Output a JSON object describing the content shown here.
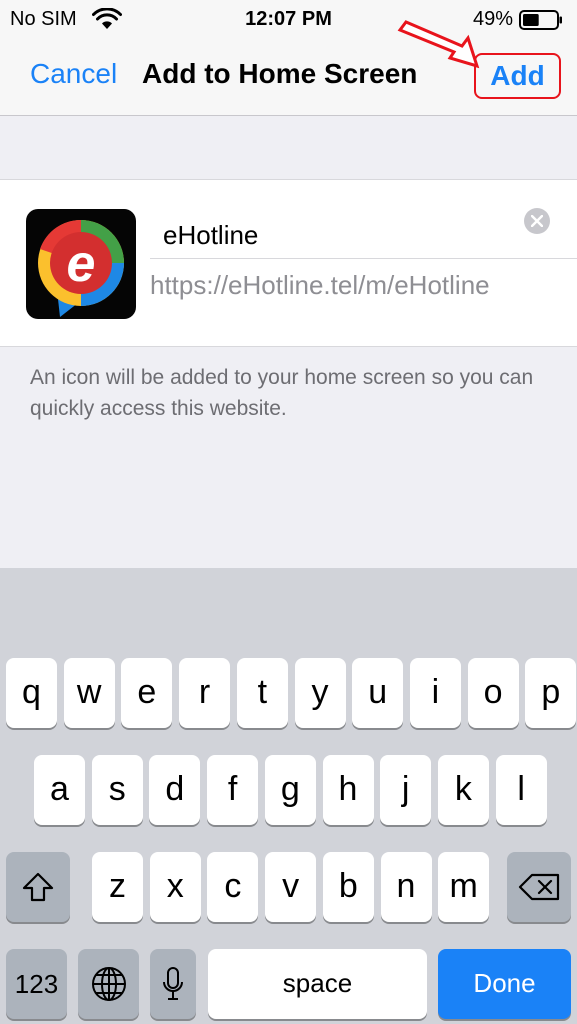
{
  "status_bar": {
    "carrier": "No SIM",
    "time": "12:07 PM",
    "battery_percent": "49%",
    "battery_level": 0.49,
    "icons": [
      "wifi-icon",
      "battery-icon"
    ]
  },
  "nav": {
    "cancel_label": "Cancel",
    "title": "Add to Home Screen",
    "add_label": "Add",
    "highlight_color": "#e8141c",
    "accent_color": "#1a82f7"
  },
  "bookmark": {
    "name_value": "eHotline",
    "url": "https://eHotline.tel/m/eHotline",
    "icon": "ehotline-app-icon"
  },
  "footer_note": "An icon will be added to your home screen so you can quickly access this website.",
  "keyboard": {
    "row1": [
      "q",
      "w",
      "e",
      "r",
      "t",
      "y",
      "u",
      "i",
      "o",
      "p"
    ],
    "row2": [
      "a",
      "s",
      "d",
      "f",
      "g",
      "h",
      "j",
      "k",
      "l"
    ],
    "row3": [
      "z",
      "x",
      "c",
      "v",
      "b",
      "n",
      "m"
    ],
    "numbers_label": "123",
    "space_label": "space",
    "done_label": "Done",
    "icons": [
      "shift-icon",
      "backspace-icon",
      "globe-icon",
      "microphone-icon"
    ]
  }
}
